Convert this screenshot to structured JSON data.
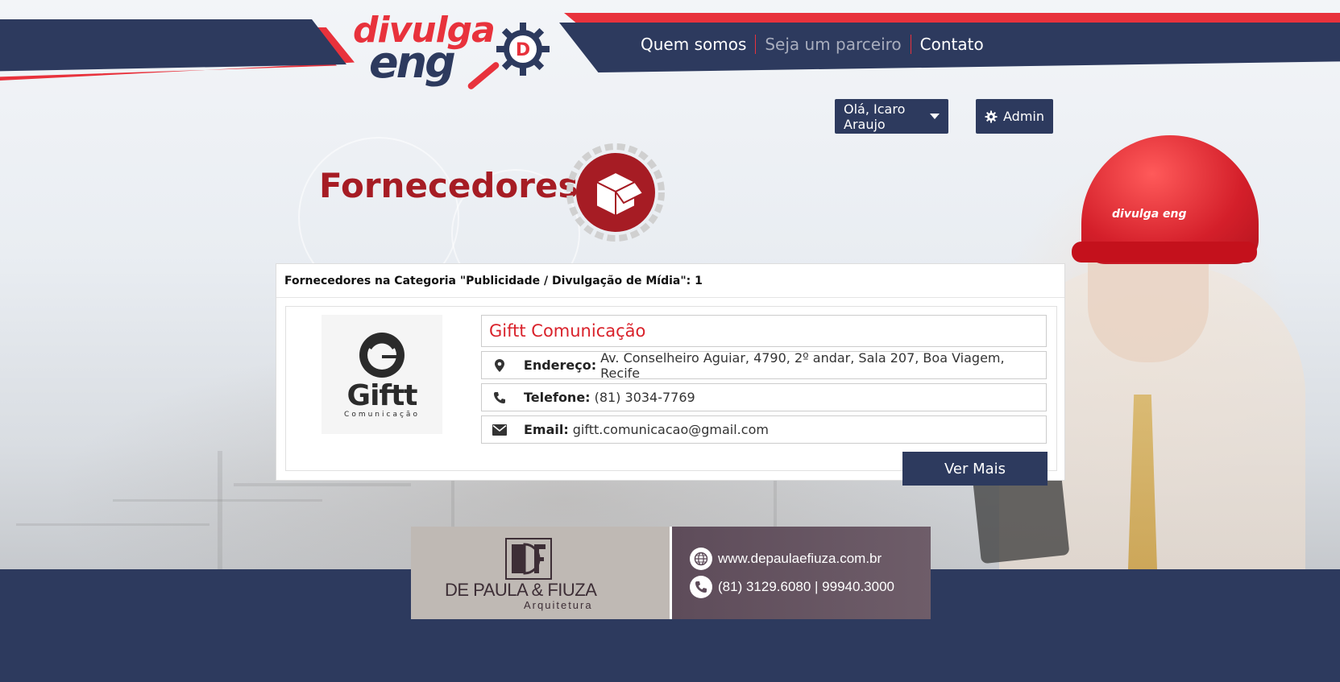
{
  "header": {
    "logo_top": "divulga",
    "logo_bottom": "eng",
    "logo_gear_letter": "D",
    "nav": [
      {
        "label": "Quem somos",
        "muted": false
      },
      {
        "label": "Seja um parceiro",
        "muted": true
      },
      {
        "label": "Contato",
        "muted": false
      }
    ]
  },
  "user_menu": {
    "greeting": "Olá, Icaro Araujo",
    "admin_label": "Admin"
  },
  "page": {
    "title": "Fornecedores"
  },
  "panel": {
    "heading": "Fornecedores na Categoria \"Publicidade / Divulgação de Mídia\": 1",
    "suppliers": [
      {
        "logo_name": "Giftt",
        "logo_sub": "Comunicação",
        "name": "Giftt Comunicação",
        "address_label": "Endereço:",
        "address": "Av. Conselheiro Aguiar, 4790, 2º andar, Sala 207, Boa Viagem, Recife",
        "phone_label": "Telefone:",
        "phone": "(81) 3034-7769",
        "email_label": "Email:",
        "email": "giftt.comunicacao@gmail.com",
        "more_label": "Ver Mais"
      }
    ]
  },
  "ad": {
    "brand": "DE PAULA & FIUZA",
    "sub": "Arquitetura",
    "website": "www.depaulaefiuza.com.br",
    "phones": "(81) 3129.6080 | 99940.3000"
  },
  "helmet_logo": "divulga eng",
  "colors": {
    "navy": "#2d3a5e",
    "red": "#e8323c",
    "title_red": "#a61c24",
    "supplier_name_red": "#d9222b"
  }
}
